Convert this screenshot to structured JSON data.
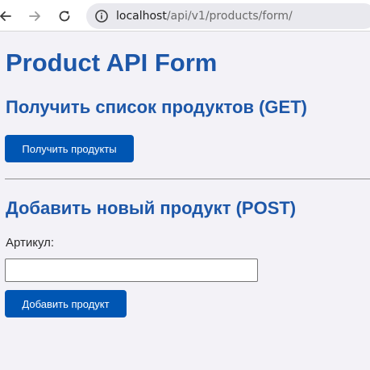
{
  "browser": {
    "url_host": "localhost",
    "url_path": "/api/v1/products/form/"
  },
  "page": {
    "title": "Product API Form",
    "get_section": {
      "title": "Получить список продуктов (GET)",
      "button_label": "Получить продукты"
    },
    "post_section": {
      "title": "Добавить новый продукт (POST)",
      "article_label": "Артикул:",
      "article_value": "",
      "button_label": "Добавить продукт"
    }
  },
  "colors": {
    "heading": "#1d57a8",
    "button": "#0056b3",
    "background": "#f3f2f7"
  },
  "icons": [
    "back-arrow-icon",
    "forward-arrow-icon",
    "reload-icon",
    "info-icon"
  ]
}
